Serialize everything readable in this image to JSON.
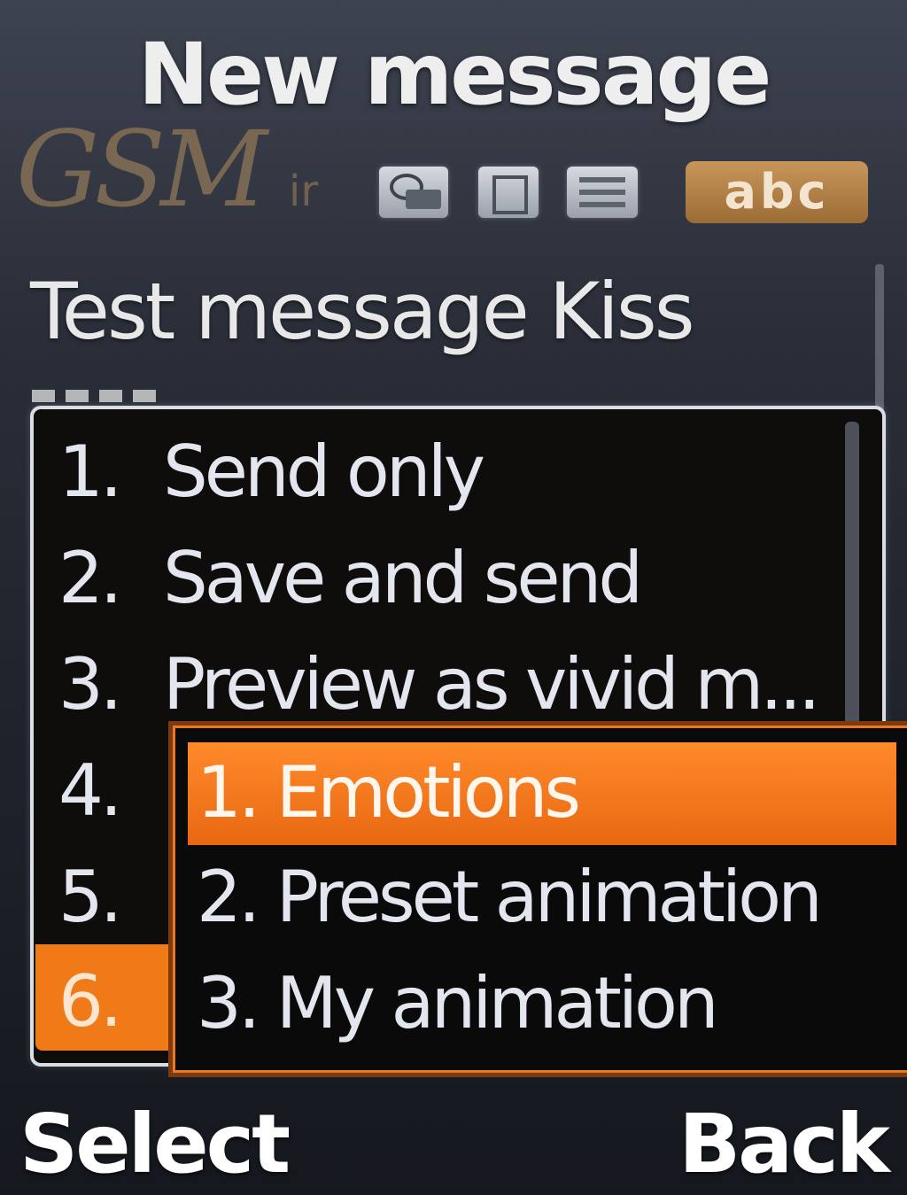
{
  "header": {
    "title": "New message",
    "input_mode": "abc",
    "status_icons": [
      "attachment-icon",
      "sim-icon",
      "message-icon"
    ]
  },
  "watermark": {
    "text": "GSM",
    "suffix": "ir"
  },
  "message": {
    "text": "Test message Kiss"
  },
  "options": [
    {
      "number": "1.",
      "label": "Send only"
    },
    {
      "number": "2.",
      "label": "Save and send"
    },
    {
      "number": "3.",
      "label": "Preview as vivid m..."
    },
    {
      "number": "4.",
      "label": ""
    },
    {
      "number": "5.",
      "label": ""
    },
    {
      "number": "6.",
      "label": ""
    }
  ],
  "submenu": {
    "items": [
      {
        "label": "1. Emotions"
      },
      {
        "label": "2. Preset animation"
      },
      {
        "label": "3. My animation"
      }
    ]
  },
  "softkeys": {
    "left": "Select",
    "right": "Back"
  }
}
